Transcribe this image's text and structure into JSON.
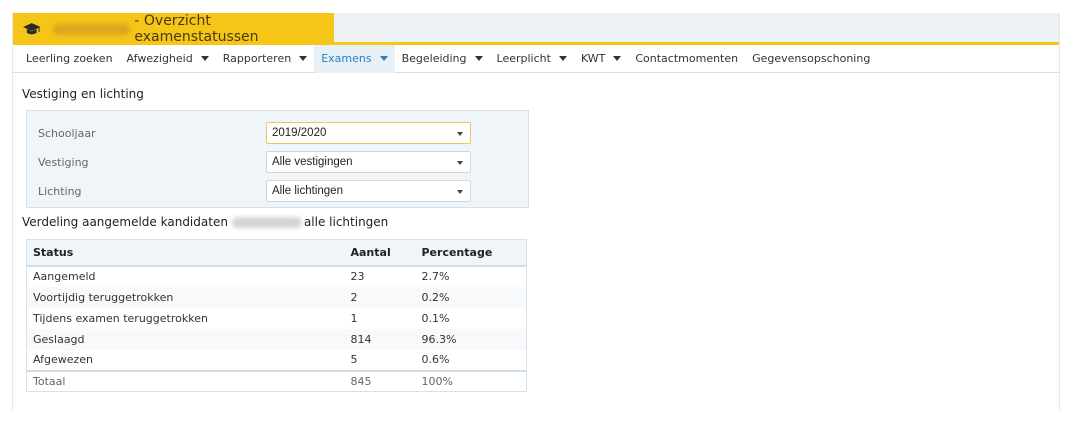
{
  "title": {
    "suffix": "- Overzicht examenstatussen"
  },
  "menu": [
    {
      "label": "Leerling zoeken",
      "dropdown": false,
      "active": false
    },
    {
      "label": "Afwezigheid",
      "dropdown": true,
      "active": false
    },
    {
      "label": "Rapporteren",
      "dropdown": true,
      "active": false
    },
    {
      "label": "Examens",
      "dropdown": true,
      "active": true
    },
    {
      "label": "Begeleiding",
      "dropdown": true,
      "active": false
    },
    {
      "label": "Leerplicht",
      "dropdown": true,
      "active": false
    },
    {
      "label": "KWT",
      "dropdown": true,
      "active": false
    },
    {
      "label": "Contactmomenten",
      "dropdown": false,
      "active": false
    },
    {
      "label": "Gegevensopschoning",
      "dropdown": false,
      "active": false
    }
  ],
  "filters": {
    "heading": "Vestiging en lichting",
    "schooljaar": {
      "label": "Schooljaar",
      "value": "2019/2020"
    },
    "vestiging": {
      "label": "Vestiging",
      "value": "Alle vestigingen"
    },
    "lichting": {
      "label": "Lichting",
      "value": "Alle lichtingen"
    }
  },
  "distribution": {
    "heading_prefix": "Verdeling aangemelde kandidaten",
    "heading_suffix": "alle lichtingen",
    "columns": [
      "Status",
      "Aantal",
      "Percentage"
    ],
    "rows": [
      {
        "status": "Aangemeld",
        "count": "23",
        "pct": "2.7%"
      },
      {
        "status": "Voortijdig teruggetrokken",
        "count": "2",
        "pct": "0.2%"
      },
      {
        "status": "Tijdens examen teruggetrokken",
        "count": "1",
        "pct": "0.1%"
      },
      {
        "status": "Geslaagd",
        "count": "814",
        "pct": "96.3%"
      },
      {
        "status": "Afgewezen",
        "count": "5",
        "pct": "0.6%"
      }
    ],
    "total": {
      "status": "Totaal",
      "count": "845",
      "pct": "100%"
    }
  },
  "colors": {
    "accent": "#f5c518",
    "active_link": "#2a7fc0"
  }
}
